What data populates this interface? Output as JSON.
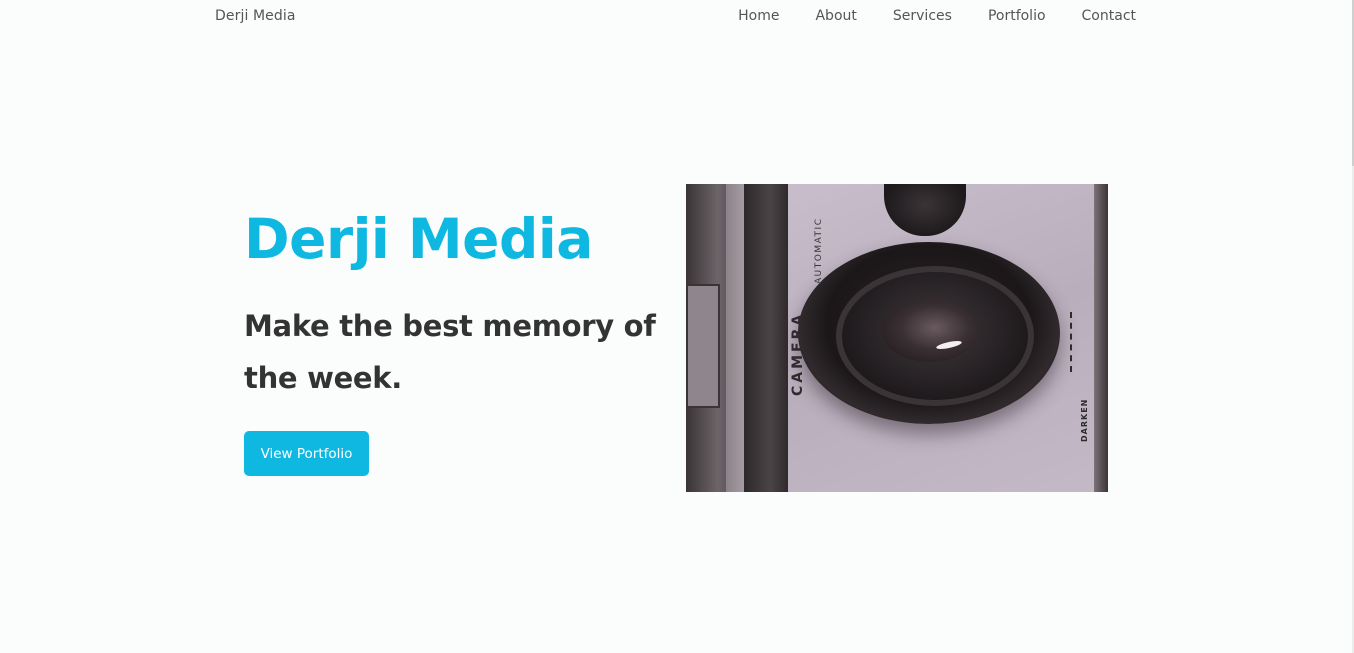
{
  "navbar": {
    "brand": "Derji Media",
    "links": [
      "Home",
      "About",
      "Services",
      "Portfolio",
      "Contact"
    ]
  },
  "hero": {
    "title": "Derji Media",
    "subtitle": "Make the best memory of the week.",
    "cta_label": "View Portfolio",
    "image": {
      "label_camera": "CAMERA",
      "label_auto": "AUTOMATIC",
      "label_darken": "DARKEN"
    }
  },
  "colors": {
    "accent": "#0fb8e1",
    "heading_text": "#333333",
    "nav_text": "#555555",
    "background": "#fbfdfd"
  }
}
